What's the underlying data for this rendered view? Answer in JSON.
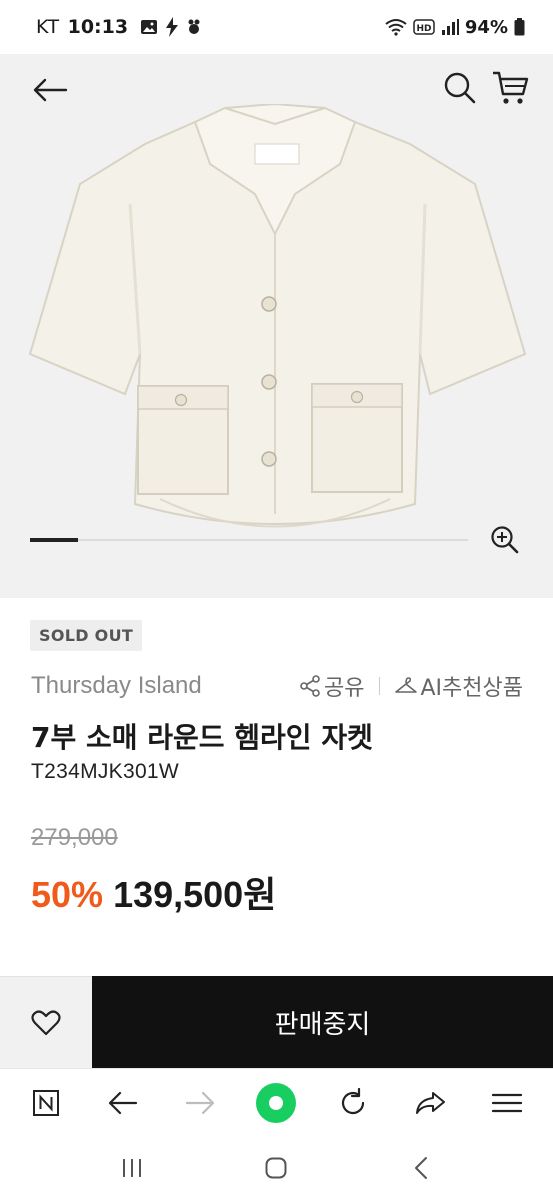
{
  "status": {
    "carrier": "KT",
    "time": "10:13",
    "battery": "94%",
    "icons": [
      "gallery-icon",
      "bolt-icon",
      "app-icon",
      "wifi-icon",
      "hd-icon",
      "signal-icon",
      "battery-icon"
    ]
  },
  "header": {
    "icons": [
      "back-arrow-icon",
      "search-icon",
      "cart-icon"
    ]
  },
  "gallery": {
    "image_description_icon": "jacket-image",
    "progress_fraction": 0.11,
    "zoom_icon": "zoom-in-icon"
  },
  "product": {
    "badge": "SOLD OUT",
    "brand": "Thursday Island",
    "share_label": "공유",
    "recommend_label": "AI추천상품",
    "title": "7부 소매 라운드 헴라인 자켓",
    "code": "T234MJK301W",
    "original_price": "279,000",
    "discount": "50%",
    "sale_price": "139,500원"
  },
  "buy": {
    "stop_label": "판매중지",
    "wish_icon": "heart-icon"
  },
  "browser": {
    "icons": [
      "naver-n-icon",
      "back-icon",
      "forward-icon",
      "green-dot-icon",
      "refresh-icon",
      "share-icon",
      "menu-icon"
    ]
  },
  "nav": {
    "icons": [
      "recents-icon",
      "home-icon",
      "back-icon"
    ]
  },
  "colors": {
    "accent_discount": "#f05a1a",
    "buy_button": "#111111",
    "green_dot": "#19ce60"
  }
}
